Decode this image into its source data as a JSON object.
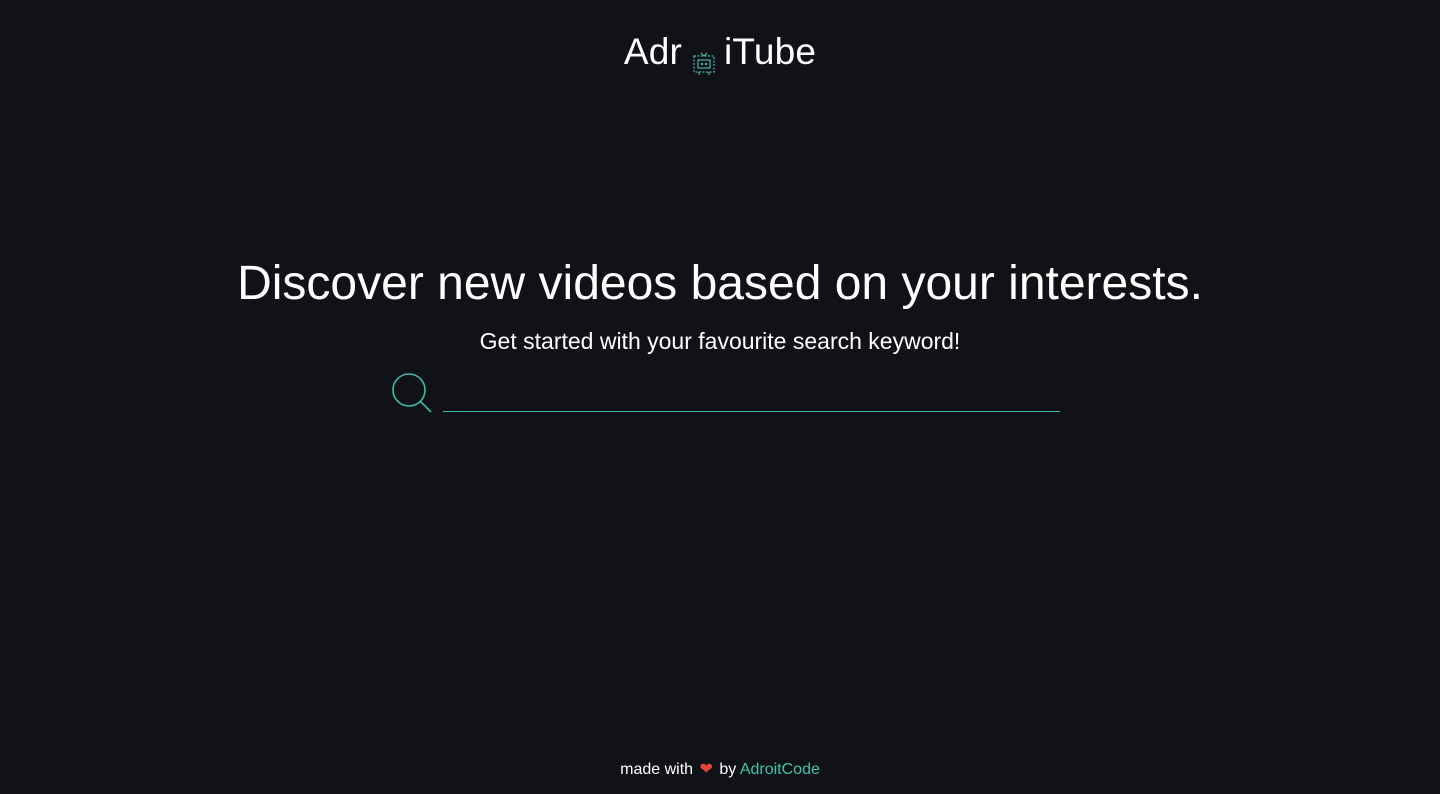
{
  "header": {
    "logo_part1": "Adr",
    "logo_part2": "iTube",
    "logo_icon": "robot-tv-icon"
  },
  "hero": {
    "title": "Discover new videos based on your interests.",
    "subtitle": "Get started with your favourite search keyword!"
  },
  "search": {
    "icon": "search-icon",
    "value": "",
    "placeholder": ""
  },
  "footer": {
    "made_with": "made with",
    "heart_glyph": "❤",
    "by": "by",
    "author_link": "AdroitCode"
  },
  "colors": {
    "background": "#111217",
    "accent": "#3fb8a9",
    "link": "#3fc4a8",
    "heart": "#e0443a",
    "text": "#ffffff"
  }
}
